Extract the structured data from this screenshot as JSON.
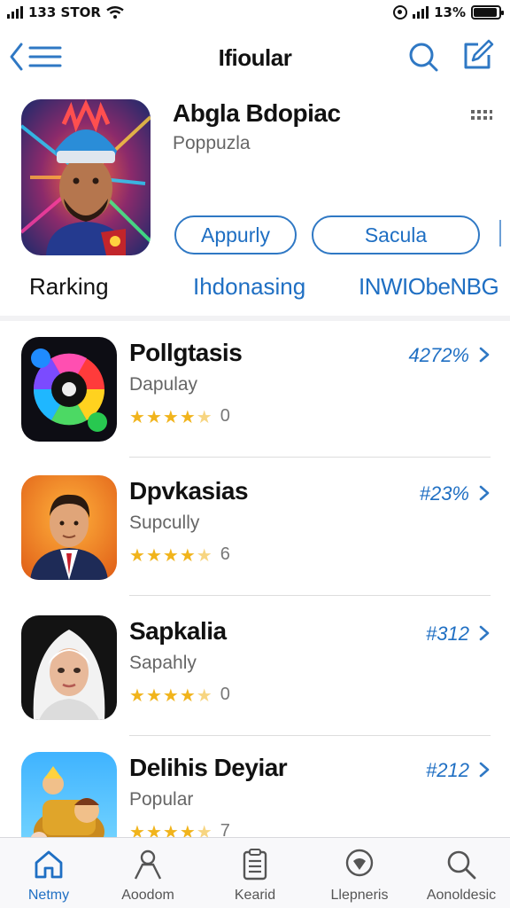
{
  "status_bar": {
    "carrier": "133 STOR",
    "battery_percent": "13%",
    "battery_level": 0.92
  },
  "nav": {
    "title": "Ifioular",
    "back_icon": "chevron-back-list-icon",
    "search_icon": "search-icon",
    "compose_icon": "compose-icon"
  },
  "featured": {
    "title": "Abgla Bdopiac",
    "subtitle": "Poppuzla",
    "button_1": "Appurly",
    "button_2": "Sacula"
  },
  "segments": [
    "Rarking",
    "Ihdonasing",
    "INWIObeNBG"
  ],
  "apps": [
    {
      "title": "Pollgtasis",
      "subtitle": "Dapulay",
      "rank": "4272%",
      "rating_count": "0",
      "stars": 4.5
    },
    {
      "title": "Dpvkasias",
      "subtitle": "Supcully",
      "rank": "#23%",
      "rating_count": "6",
      "stars": 4.5
    },
    {
      "title": "Sapkalia",
      "subtitle": "Sapahly",
      "rank": "#312",
      "rating_count": "0",
      "stars": 4.5
    },
    {
      "title": "Delihis Deyiar",
      "subtitle": "Popular",
      "rank": "#212",
      "rating_count": "7",
      "stars": 4.5
    }
  ],
  "tabs": [
    {
      "label": "Netmy",
      "icon": "home-icon"
    },
    {
      "label": "Aoodom",
      "icon": "person-icon"
    },
    {
      "label": "Kearid",
      "icon": "clipboard-icon"
    },
    {
      "label": "Llepneris",
      "icon": "location-pin-icon"
    },
    {
      "label": "Aonoldesic",
      "icon": "search-icon"
    }
  ],
  "colors": {
    "accent": "#1f6fc3",
    "star": "#f1b41c"
  }
}
